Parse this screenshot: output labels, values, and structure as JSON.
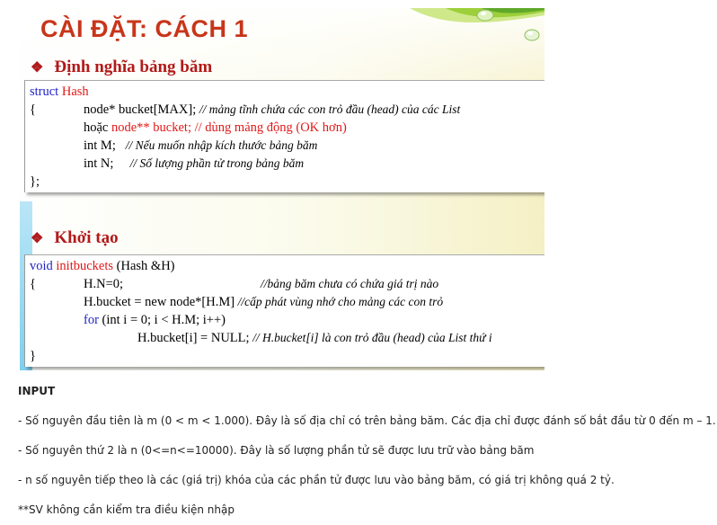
{
  "slide": {
    "title": "CÀI ĐẶT: CÁCH  1",
    "section1": {
      "bullet": "❖",
      "heading": "Định nghĩa bảng băm",
      "code": {
        "line1_kw": "struct",
        "line1_name": "Hash",
        "line2_brace": "{",
        "line2_code": "node* bucket[MAX];",
        "line2_comment": "// mảng tĩnh chứa các con trỏ đầu (head) của các List",
        "line3_prefix": "hoặc",
        "line3_code": "node** bucket; // dùng mảng động (OK hơn)",
        "line4_code": "int M;",
        "line4_comment": "// Nếu muốn nhập kích thước bảng băm",
        "line5_code": "int N;",
        "line5_comment": "// Số lượng phần tử trong bảng băm",
        "line6": "};"
      }
    },
    "section2": {
      "bullet": "❖",
      "heading": "Khởi tạo",
      "code": {
        "line1_kw": "void",
        "line1_name": "initbuckets",
        "line1_rest": "(Hash &H)",
        "line2_brace": "{",
        "line2_code": "H.N=0;",
        "line2_comment": "//bảng băm chưa có chứa giá trị nào",
        "line3_code": "H.bucket = new node*[H.M]",
        "line3_comment": "//cấp phát vùng nhớ cho mảng các con trỏ",
        "line4_kw": "for",
        "line4_rest": "(int i = 0; i < H.M; i++)",
        "line5_code": "H.bucket[i] = NULL;",
        "line5_comment": "// H.bucket[i] là con trỏ đầu (head) của List thứ i",
        "line6": "}"
      }
    }
  },
  "input_section": {
    "heading": "INPUT",
    "lines": [
      " - Số nguyên đầu tiên là m (0 < m < 1.000). Đây là số địa chỉ có trên bảng băm. Các địa chỉ được đánh số bắt đầu từ 0 đến m – 1.",
      "- Số nguyên thứ 2 là n (0<=n<=10000). Đây là số lượng phần tử sẽ được lưu trữ vào bảng băm",
      "- n số nguyên tiếp theo là các (giá trị) khóa của các phần tử được lưu vào bảng băm, có giá trị không quá 2 tỷ.",
      " **SV không cần kiểm tra điều kiện nhập"
    ]
  },
  "colors": {
    "title": "#c8351a",
    "heading": "#b11a1a",
    "keyword": "#1f1fc7",
    "highlight": "#e01818"
  }
}
